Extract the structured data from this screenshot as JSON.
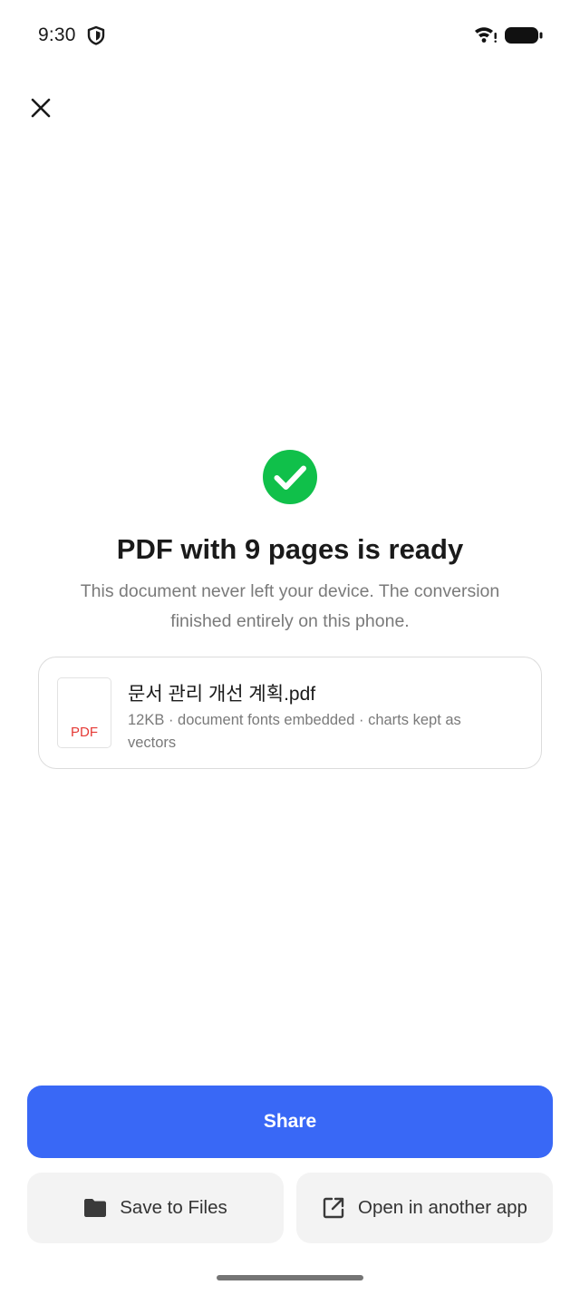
{
  "status_bar": {
    "time": "9:30"
  },
  "content": {
    "title": "PDF with 9 pages is ready",
    "subtitle": "This document never left your device. The conversion finished entirely on this phone."
  },
  "file": {
    "thumb_label": "PDF",
    "name": "문서 관리 개선 계획.pdf",
    "meta": "12KB · document fonts embedded · charts kept as vectors"
  },
  "actions": {
    "share_label": "Share",
    "save_label": "Save to Files",
    "open_label": "Open in another app"
  },
  "colors": {
    "accent": "#3968f6",
    "success": "#10c04a",
    "pdf_label": "#e53935"
  },
  "icons": {
    "close": "close-icon",
    "success": "check-circle-icon",
    "save": "folder-icon",
    "open": "open-external-icon"
  }
}
